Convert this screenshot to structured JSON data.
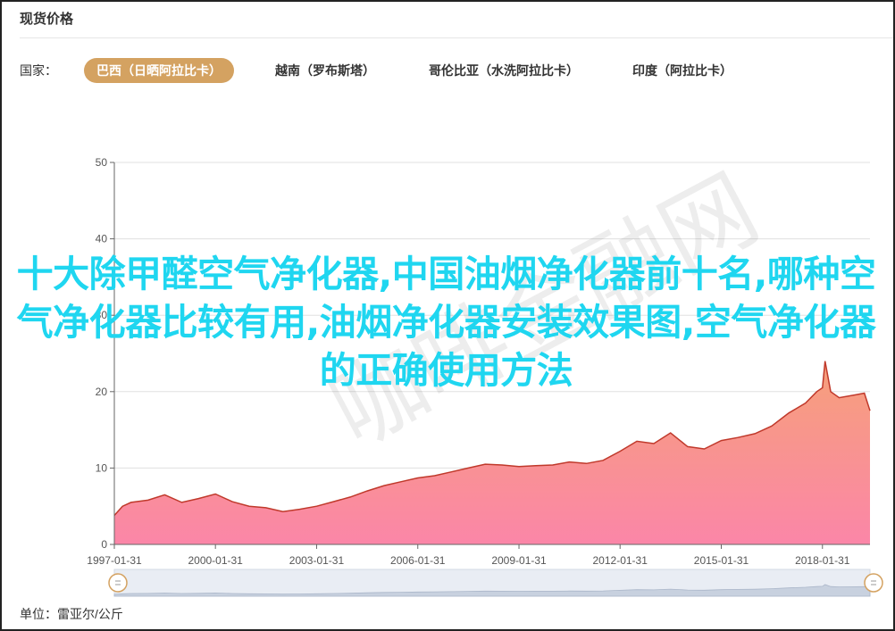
{
  "panel": {
    "title": "现货价格"
  },
  "tabs": {
    "label": "国家：",
    "items": [
      {
        "label": "巴西（日晒阿拉比卡）",
        "active": true
      },
      {
        "label": "越南（罗布斯塔）",
        "active": false
      },
      {
        "label": "哥伦比亚（水洗阿拉比卡）",
        "active": false
      },
      {
        "label": "印度（阿拉比卡）",
        "active": false
      }
    ]
  },
  "unit": "单位：雷亚尔/公斤",
  "overlay_text": "十大除甲醛空气净化器,中国油烟净化器前十名,哪种空气净化器比较有用,油烟净化器安装效果图,空气净化器的正确使用方法",
  "watermark": "咖啡金融网",
  "colors": {
    "accent": "#d4a261",
    "line": "#c0392b",
    "area_top": "#f6a07a",
    "area_bottom": "#fb86a8",
    "overlay": "#1fd6f0"
  },
  "chart_data": {
    "type": "area",
    "title": "",
    "xlabel": "",
    "ylabel": "",
    "ylim": [
      0,
      50
    ],
    "yticks": [
      0,
      10,
      20,
      30,
      40,
      50
    ],
    "xlim": [
      "1997-01-31",
      "2019-06-30"
    ],
    "xticks": [
      "1997-01-31",
      "2000-01-31",
      "2003-01-31",
      "2006-01-31",
      "2009-01-31",
      "2012-01-31",
      "2015-01-31",
      "2018-01-31"
    ],
    "grid": true,
    "series": [
      {
        "x": [
          "1997-01-31",
          "1997-04-30",
          "1997-07-31",
          "1998-01-31",
          "1998-07-31",
          "1999-01-31",
          "1999-07-31",
          "2000-01-31",
          "2000-07-31",
          "2001-01-31",
          "2001-07-31",
          "2002-01-31",
          "2002-07-31",
          "2003-01-31",
          "2003-07-31",
          "2004-01-31",
          "2004-07-31",
          "2005-01-31",
          "2005-07-31",
          "2006-01-31",
          "2006-07-31",
          "2007-01-31",
          "2007-07-31",
          "2008-01-31",
          "2008-07-31",
          "2009-01-31",
          "2009-07-31",
          "2010-01-31",
          "2010-07-31",
          "2011-01-31",
          "2011-07-31",
          "2012-01-31",
          "2012-07-31",
          "2013-01-31",
          "2013-07-31",
          "2014-01-31",
          "2014-07-31",
          "2015-01-31",
          "2015-07-31",
          "2016-01-31",
          "2016-07-31",
          "2017-01-31",
          "2017-07-31",
          "2017-11-30",
          "2018-01-31",
          "2018-02-28",
          "2018-04-30",
          "2018-07-31",
          "2019-01-31",
          "2019-04-30",
          "2019-06-30"
        ],
        "values": [
          3.8,
          5.0,
          5.5,
          5.8,
          6.5,
          5.5,
          6.0,
          6.6,
          5.6,
          5.0,
          4.8,
          4.3,
          4.6,
          5.0,
          5.6,
          6.2,
          7.0,
          7.7,
          8.2,
          8.7,
          9.0,
          9.5,
          10.0,
          10.5,
          10.4,
          10.2,
          10.3,
          10.4,
          10.8,
          10.6,
          11.0,
          12.2,
          13.5,
          13.2,
          14.6,
          12.8,
          12.5,
          13.6,
          14.0,
          14.5,
          15.5,
          17.2,
          18.5,
          20.0,
          20.5,
          24.0,
          20.0,
          19.2,
          19.6,
          19.8,
          17.5
        ]
      }
    ]
  }
}
